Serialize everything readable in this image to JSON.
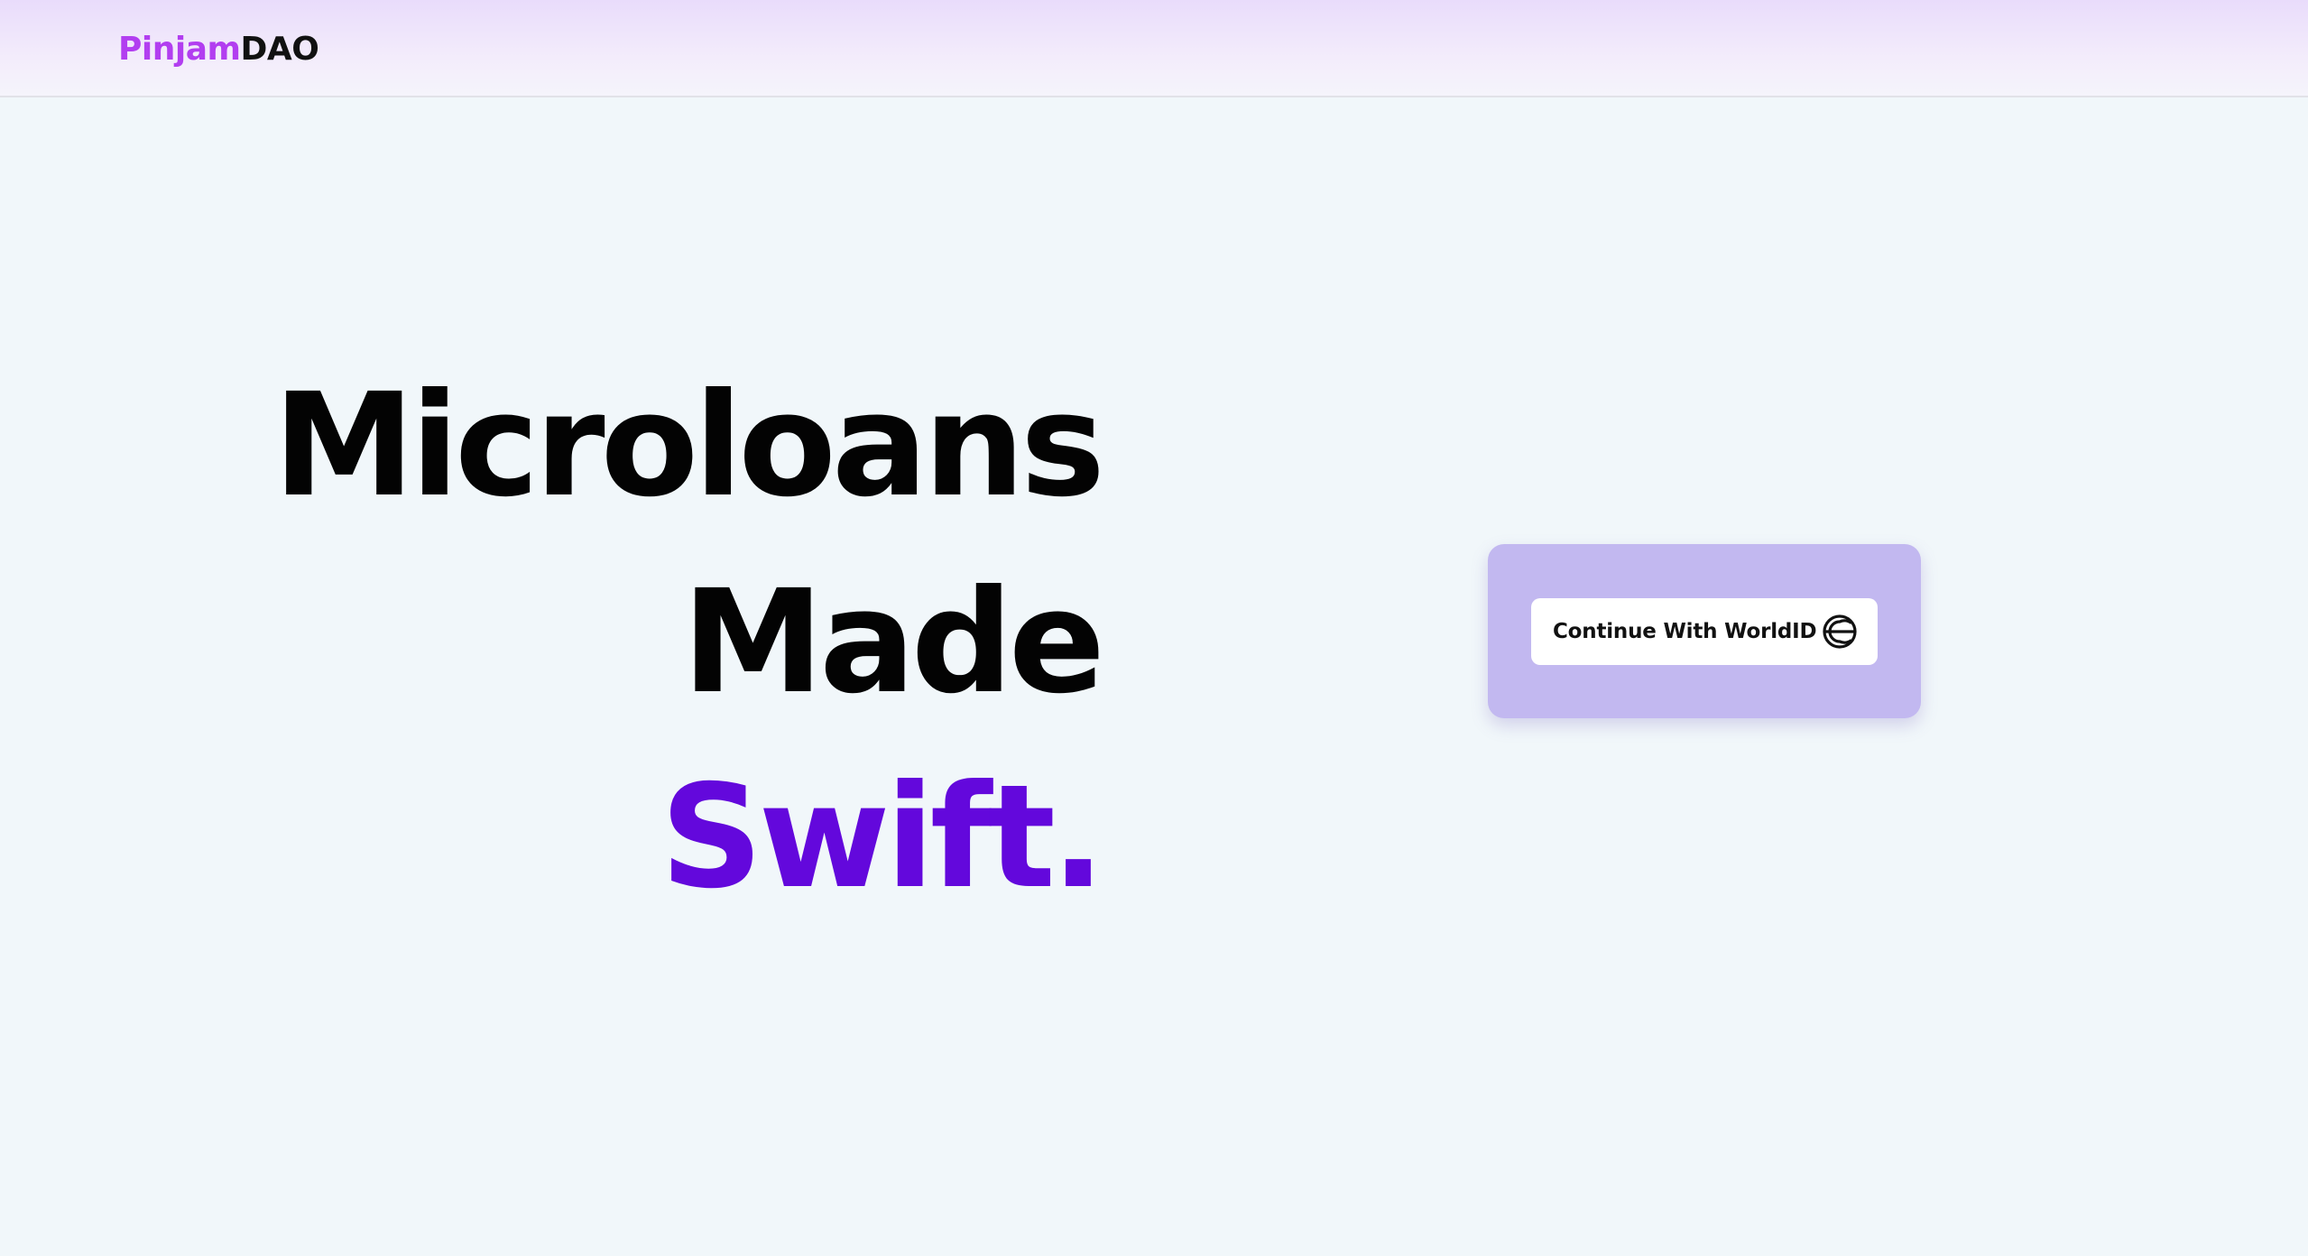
{
  "header": {
    "logo_part1": "Pinjam",
    "logo_part2": "DAO"
  },
  "hero": {
    "line1": "Microloans",
    "line2": "Made",
    "line3": "Swift."
  },
  "auth_card": {
    "button_label": "Continue With WorldID",
    "button_icon": "worldcoin-icon"
  },
  "colors": {
    "brand_purple": "#b23ef0",
    "accent_violet": "#6308dc",
    "card_bg": "#c2b8f0",
    "page_bg": "#f1f7fa"
  }
}
